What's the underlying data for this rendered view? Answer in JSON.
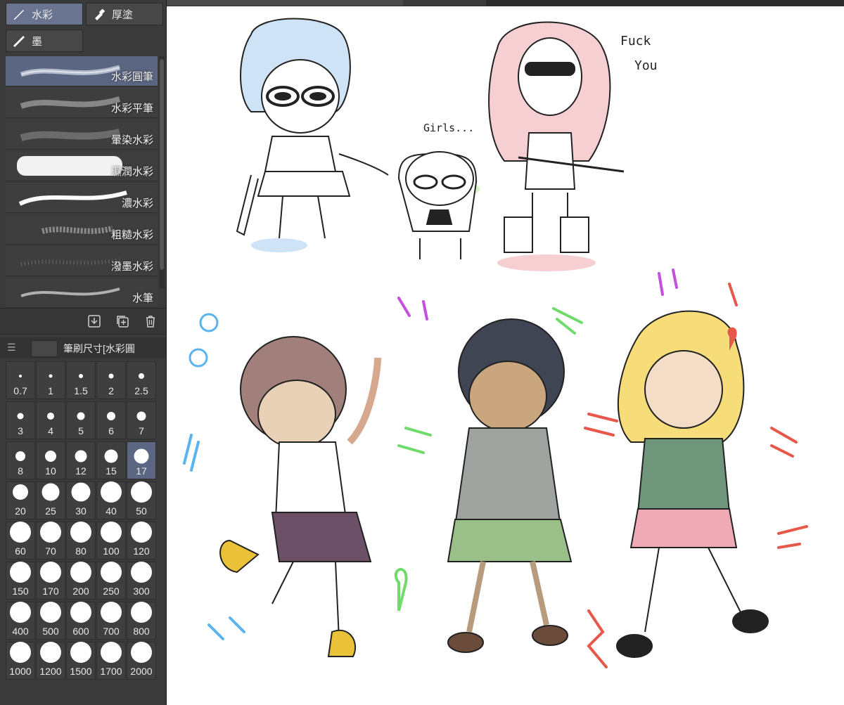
{
  "subtool_tabs": [
    {
      "label": "水彩",
      "icon": "watercolor-brush-icon",
      "active": true
    },
    {
      "label": "厚塗",
      "icon": "thick-paint-brush-icon",
      "active": false
    },
    {
      "label": "墨",
      "icon": "ink-brush-icon",
      "active": false
    }
  ],
  "brushes": [
    {
      "label": "水彩圓筆",
      "active": true
    },
    {
      "label": "水彩平筆",
      "active": false
    },
    {
      "label": "暈染水彩",
      "active": false
    },
    {
      "label": "濕潤水彩",
      "active": false
    },
    {
      "label": "濃水彩",
      "active": false
    },
    {
      "label": "粗糙水彩",
      "active": false
    },
    {
      "label": "潑墨水彩",
      "active": false
    },
    {
      "label": "水筆",
      "active": false
    }
  ],
  "panel_actions": {
    "import_icon": "download-icon",
    "duplicate_icon": "add-copy-icon",
    "delete_icon": "trash-icon"
  },
  "brush_size_panel": {
    "title": "筆刷尺寸[水彩圓",
    "menu_icon": "hamburger-menu-icon"
  },
  "brush_sizes": [
    "0.7",
    "1",
    "1.5",
    "2",
    "2.5",
    "3",
    "4",
    "5",
    "6",
    "7",
    "8",
    "10",
    "12",
    "15",
    "17",
    "20",
    "25",
    "30",
    "40",
    "50",
    "60",
    "70",
    "80",
    "100",
    "120",
    "150",
    "170",
    "200",
    "250",
    "300",
    "400",
    "500",
    "600",
    "700",
    "800",
    "1000",
    "1200",
    "1500",
    "1700",
    "2000"
  ],
  "selected_size": "17",
  "document_tabs": [
    "",
    ""
  ],
  "canvas": {
    "speech_top_right_1": "Fuck",
    "speech_top_right_2": "You",
    "speech_middle": "Girls..."
  },
  "colors": {
    "panel_bg": "#3a3a3a",
    "selection": "#5b6683",
    "canvas_bg": "#ffffff"
  }
}
